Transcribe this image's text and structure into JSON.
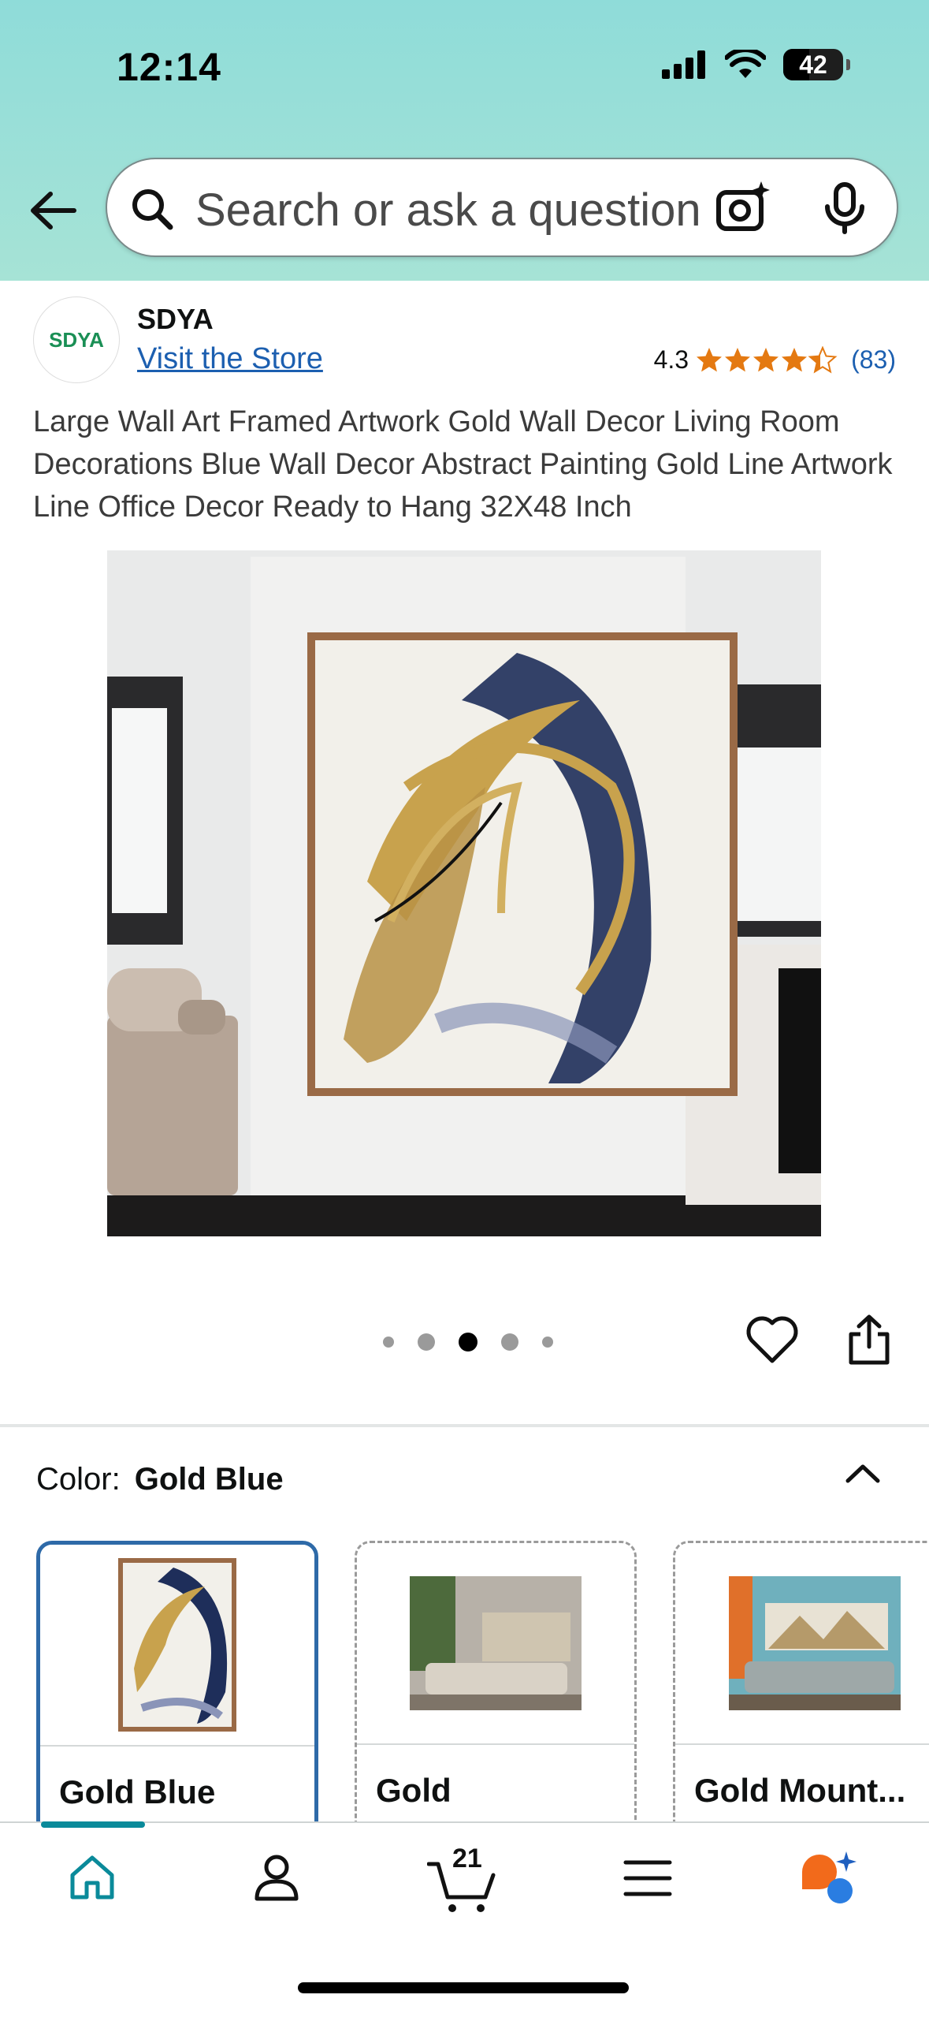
{
  "status_bar": {
    "time": "12:14",
    "battery": "42"
  },
  "search": {
    "placeholder": "Search or ask a question"
  },
  "brand": {
    "logo_text": "SDYA",
    "name": "SDYA",
    "store_link": "Visit the Store"
  },
  "rating": {
    "score": "4.3",
    "stars": 4.3,
    "count": "(83)"
  },
  "product": {
    "title": "Large Wall Art Framed Artwork Gold Wall Decor Living Room Decorations Blue Wall Decor Abstract Painting Gold Line Artwork Line Office Decor Ready to Hang 32X48 Inch",
    "image_count": 5,
    "active_image": 3
  },
  "color_selector": {
    "label": "Color:",
    "selected": "Gold Blue",
    "options": [
      {
        "label": "Gold Blue"
      },
      {
        "label": "Gold"
      },
      {
        "label": "Gold Mount..."
      }
    ]
  },
  "tab_bar": {
    "items": [
      "home",
      "account",
      "cart",
      "menu",
      "rufus"
    ],
    "cart_count": "21",
    "active": "home"
  },
  "colors": {
    "accent": "#0a8a9a",
    "link": "#1c5fb0",
    "star": "#e47911",
    "selected_border": "#2e6aa8"
  }
}
